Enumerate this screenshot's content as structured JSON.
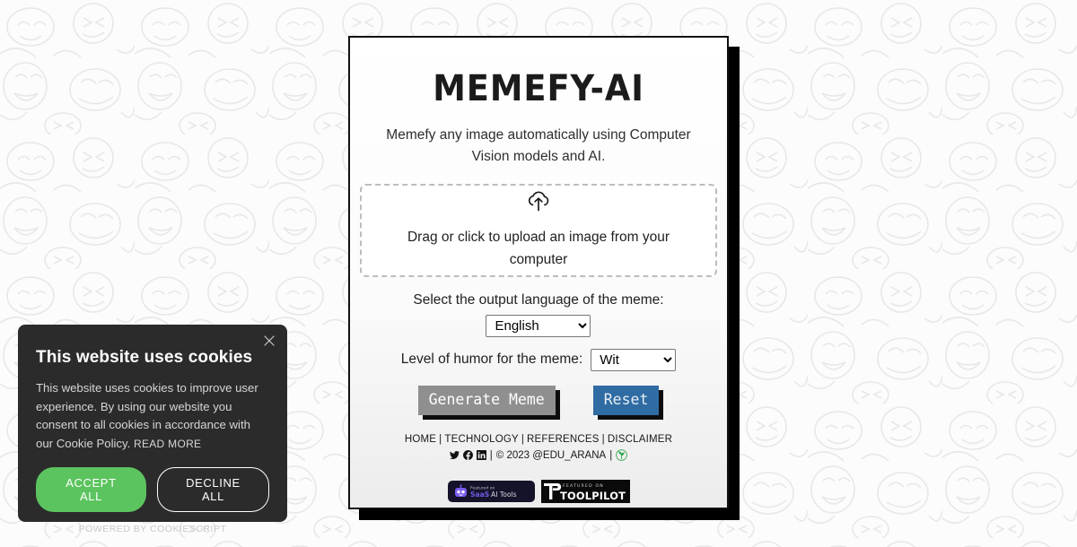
{
  "app": {
    "title": "MEMEFY-AI",
    "subtitle": "Memefy any image automatically using Computer Vision models and AI."
  },
  "upload": {
    "icon": "cloud-upload-icon",
    "text": "Drag or click to upload an image from your computer"
  },
  "form": {
    "language_label": "Select the output language of the meme:",
    "language_value": "English",
    "language_options": [
      "English"
    ],
    "humor_label": "Level of humor for the meme:",
    "humor_value": "Wit",
    "humor_options": [
      "Wit"
    ]
  },
  "actions": {
    "generate_label": "Generate Meme",
    "reset_label": "Reset",
    "generate_color": "#8f8f8f",
    "reset_color": "#2f6ca3"
  },
  "footer": {
    "nav": [
      "HOME",
      "TECHNOLOGY",
      "REFERENCES",
      "DISCLAIMER"
    ],
    "separator": "|",
    "copyright": "© 2023 @EDU_ARANA",
    "social": [
      "twitter-icon",
      "facebook-icon",
      "linkedin-icon"
    ],
    "trailing_icon": "green-leaf-icon",
    "badges": [
      {
        "name": "saas-ai-tools-badge",
        "small_text": "Featured on",
        "main_text": "SaaS AI Tools"
      },
      {
        "name": "toolpilot-badge",
        "small_text": "FEATURED ON",
        "main_text": "TOOLPILOT"
      }
    ]
  },
  "cookie_banner": {
    "title": "This website uses cookies",
    "body": "This website uses cookies to improve user experience. By using our website you consent to all cookies in accordance with our Cookie Policy.",
    "read_more": "READ MORE",
    "accept_label": "ACCEPT ALL",
    "decline_label": "DECLINE ALL",
    "powered_by": "POWERED BY COOKIESCRIPT",
    "accent_color": "#5cc45f",
    "background_color": "#2b2b2b",
    "close_icon": "close-icon"
  }
}
